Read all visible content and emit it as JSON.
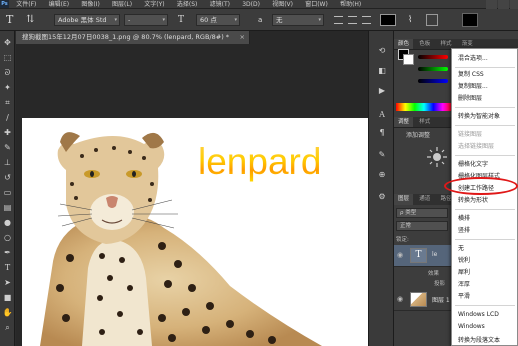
{
  "menubar": {
    "logo": "Ps",
    "items": [
      "文件(F)",
      "编辑(E)",
      "图像(I)",
      "图层(L)",
      "文字(Y)",
      "选择(S)",
      "滤镜(T)",
      "3D(D)",
      "视图(V)",
      "窗口(W)",
      "帮助(H)"
    ]
  },
  "options": {
    "font_family": "Adobe 黑体 Std",
    "font_style": "-",
    "font_size": "60 点",
    "aa_prefix": "a",
    "aa_mode": "无"
  },
  "document": {
    "tab_title": "搜狗截图15年12月07日0038_1.png @ 80.7% (lenpard, RGB/8#) *",
    "close": "×",
    "canvas_text": "lenpard"
  },
  "panels": {
    "top_tabs": [
      "颜色",
      "色板",
      "样式",
      "渐变"
    ],
    "mid_tabs": [
      "调整",
      "样式"
    ],
    "adjust_label": "添加调整",
    "layers_tabs": [
      "图层",
      "通道",
      "路径"
    ],
    "kind_label": "ρ 类型",
    "blend_mode": "正常",
    "lock_label": "锁定:",
    "layers": [
      {
        "name": "le",
        "type": "text"
      },
      {
        "name": "效果",
        "type": "fx"
      },
      {
        "name": "投影",
        "type": "fx-item"
      },
      {
        "name": "图层 1",
        "type": "image"
      }
    ]
  },
  "context_menu": {
    "items": [
      {
        "label": "混合选项...",
        "disabled": false
      },
      {
        "label": "复制 CSS",
        "disabled": false
      },
      {
        "label": "复制图层...",
        "disabled": false
      },
      {
        "label": "删除图层",
        "disabled": false
      },
      {
        "label": "转换为智能对象",
        "disabled": false
      },
      {
        "label": "链接图层",
        "disabled": true
      },
      {
        "label": "选择链接图层",
        "disabled": true
      },
      {
        "label": "栅格化文字",
        "disabled": false
      },
      {
        "label": "栅格化图层样式",
        "disabled": false
      },
      {
        "label": "创建工作路径",
        "disabled": false
      },
      {
        "label": "转换为形状",
        "disabled": false
      },
      {
        "label": "横排",
        "disabled": false
      },
      {
        "label": "竖排",
        "disabled": false
      },
      {
        "label": "无",
        "disabled": false
      },
      {
        "label": "锐利",
        "disabled": false
      },
      {
        "label": "犀利",
        "disabled": false
      },
      {
        "label": "浑厚",
        "disabled": false
      },
      {
        "label": "平滑",
        "disabled": false
      },
      {
        "label": "Windows LCD",
        "disabled": false
      },
      {
        "label": "Windows",
        "disabled": false
      },
      {
        "label": "转换为段落文本",
        "disabled": false
      }
    ],
    "highlight_color": "#e01818"
  },
  "colors": {
    "text_gradient_top": "#ffd24a",
    "text_gradient_bottom": "#ff9c00",
    "ui_dark": "#2b2b2b",
    "panel": "#3d3d3d"
  },
  "icons": {
    "toolbox": [
      "move-icon",
      "marquee-icon",
      "lasso-icon",
      "magic-wand-icon",
      "crop-icon",
      "eyedropper-icon",
      "healing-icon",
      "brush-icon",
      "stamp-icon",
      "history-brush-icon",
      "eraser-icon",
      "gradient-icon",
      "blur-icon",
      "dodge-icon",
      "pen-icon",
      "type-icon",
      "path-select-icon",
      "shape-icon",
      "hand-icon",
      "zoom-icon"
    ],
    "iconcol": [
      "history-icon",
      "properties-icon",
      "actions-icon",
      "character-icon",
      "paragraph-icon",
      "brush-preset-icon",
      "clone-source-icon",
      "tool-preset-icon"
    ]
  }
}
